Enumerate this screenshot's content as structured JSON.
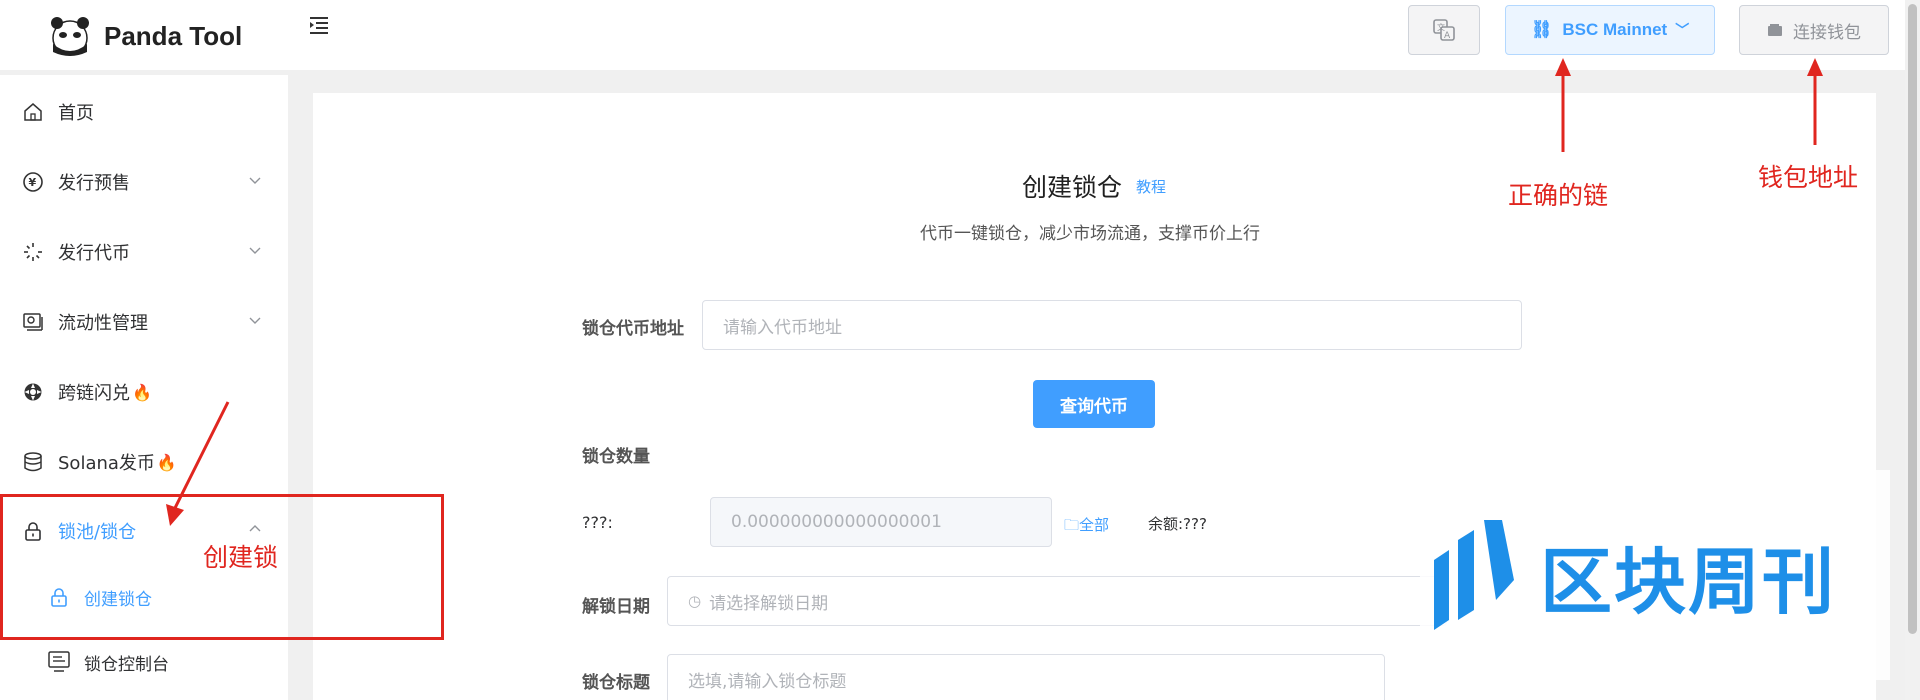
{
  "app": {
    "name": "Panda Tool"
  },
  "header": {
    "chain_label": "BSC Mainnet",
    "wallet_label": "连接钱包"
  },
  "sidebar": {
    "items": [
      {
        "label": "首页"
      },
      {
        "label": "发行预售"
      },
      {
        "label": "发行代币"
      },
      {
        "label": "流动性管理"
      },
      {
        "label": "跨链闪兑"
      },
      {
        "label": "Solana发币"
      },
      {
        "label": "锁池/锁仓"
      },
      {
        "label": "创建锁仓"
      },
      {
        "label": "锁仓控制台"
      }
    ],
    "fire_icon": "🔥"
  },
  "form": {
    "title": "创建锁仓",
    "tutorial_link": "教程",
    "subtitle": "代币一键锁仓，减少市场流通，支撑币价上行",
    "token_address_label": "锁仓代币地址",
    "token_address_placeholder": "请输入代币地址",
    "query_button": "查询代币",
    "amount_label": "锁仓数量",
    "symbol_label": "???:",
    "amount_placeholder": "0.000000000000000001",
    "all_button": "全部",
    "balance_text": "余额:???",
    "unlock_date_label": "解锁日期",
    "unlock_date_placeholder": "请选择解锁日期",
    "lock_title_label": "锁仓标题",
    "lock_title_placeholder": "选填,请输入锁仓标题"
  },
  "annotations": {
    "correct_chain": "正确的链",
    "wallet_address": "钱包地址",
    "create_lock": "创建锁"
  },
  "watermark": {
    "text": "区块周刊"
  },
  "colors": {
    "accent": "#409eff",
    "annotation": "#e0261f"
  }
}
